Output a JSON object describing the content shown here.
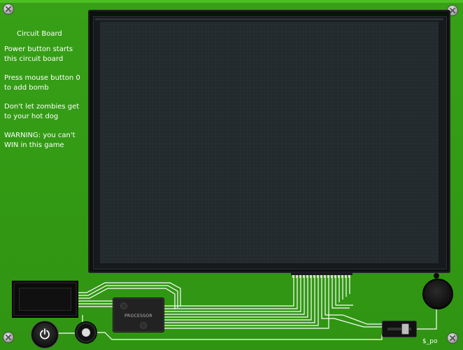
{
  "sidebar": {
    "title": "Circuit Board",
    "lines": [
      "Power button starts this circuit board",
      "Press mouse button 0 to add bomb",
      "Don't let zombies get to your hot dog",
      "WARNING: you can't WIN in this game"
    ]
  },
  "processor": {
    "label": "PROCESSOR"
  },
  "author": "$_po",
  "colors": {
    "board": "#2f9412",
    "trace": "#ffffff",
    "screen": "#222a2d"
  },
  "icons": {
    "power": "power-icon",
    "screw": "screw-icon"
  }
}
